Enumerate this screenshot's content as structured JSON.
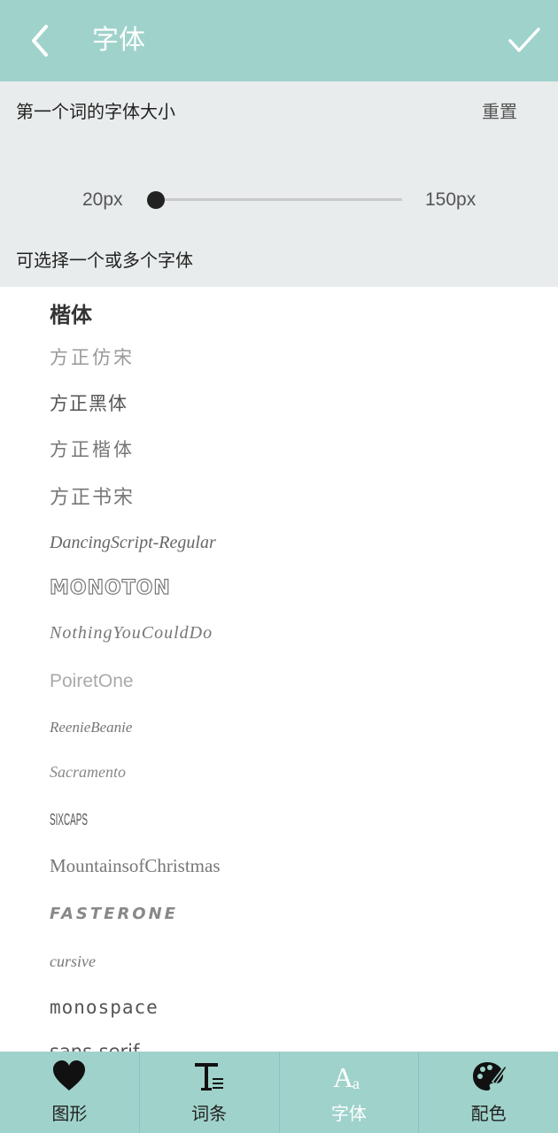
{
  "header": {
    "title": "字体"
  },
  "settings": {
    "title": "第一个词的字体大小",
    "reset_label": "重置",
    "slider": {
      "min_label": "20px",
      "max_label": "150px",
      "value_fraction": 0.0
    },
    "hint": "可选择一个或多个字体"
  },
  "fonts": [
    "楷体",
    "方正仿宋",
    "方正黑体",
    "方正楷体",
    "方正书宋",
    "DancingScript-Regular",
    "MONOTON",
    "NothingYouCouldDo",
    "PoiretOne",
    "ReenieBeanie",
    "Sacramento",
    "SIXCAPS",
    "MountainsofChristmas",
    "FASTERONE",
    "cursive",
    "monospace",
    "sans-serif"
  ],
  "nav": [
    {
      "label": "图形",
      "icon": "heart-icon"
    },
    {
      "label": "词条",
      "icon": "text-format-icon"
    },
    {
      "label": "字体",
      "icon": "font-aa-icon"
    },
    {
      "label": "配色",
      "icon": "palette-icon"
    }
  ],
  "colors": {
    "accent": "#9fd2cb",
    "panel": "#e8ecec",
    "nav_active_text": "#ffffff",
    "nav_text": "#222222"
  }
}
